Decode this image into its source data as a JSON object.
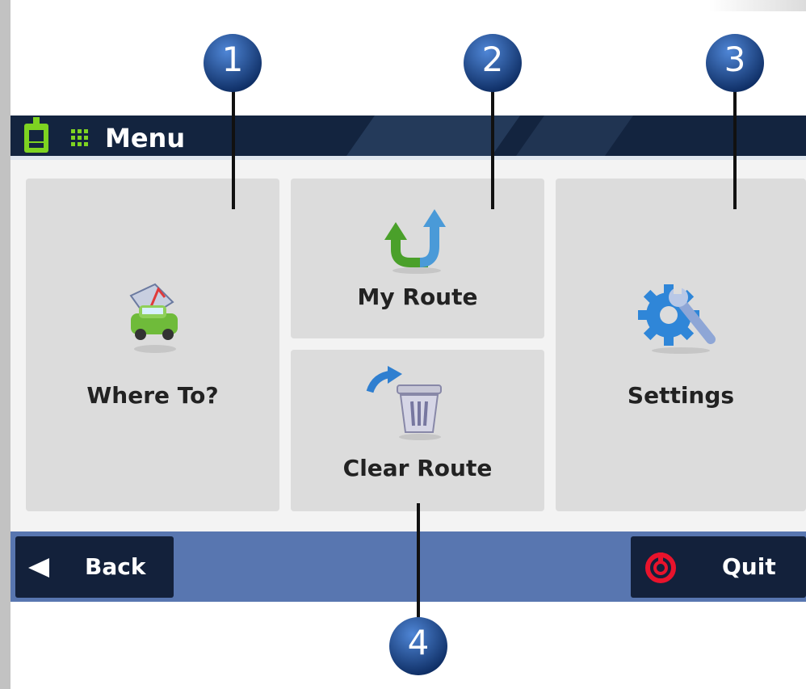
{
  "header": {
    "title": "Menu"
  },
  "tiles": {
    "where_to": "Where To?",
    "my_route": "My Route",
    "clear_route": "Clear Route",
    "settings": "Settings"
  },
  "bottom_bar": {
    "back_label": "Back",
    "quit_label": "Quit"
  },
  "callouts": [
    "1",
    "2",
    "3",
    "4"
  ],
  "icons": [
    "menu-icon",
    "grid-icon",
    "car-icon",
    "route-arrows-icon",
    "trash-icon",
    "gear-wrench-icon",
    "back-arrow-icon",
    "power-icon"
  ],
  "colors": {
    "titlebar": "#13243f",
    "tile": "#dcdcdc",
    "bottombar": "#5876b0",
    "button": "#13213b",
    "accent_green": "#7ed321",
    "callout_blue": "#1f4f9a",
    "quit_red": "#e8132c"
  }
}
